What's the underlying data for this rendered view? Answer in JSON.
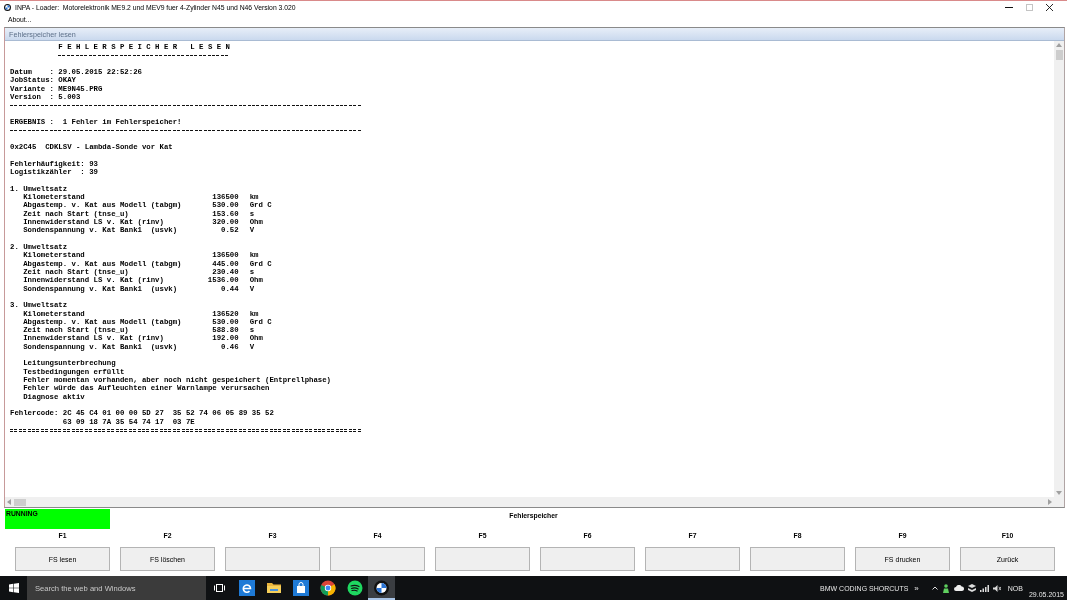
{
  "window": {
    "title": "INPA - Loader:  Motorelektronik ME9.2 und MEV9 fuer 4-Zylinder N45 und N46 Version 3.020",
    "controls": [
      {
        "kind": "minimize",
        "disabled": false
      },
      {
        "kind": "maximize",
        "disabled": true
      },
      {
        "kind": "close",
        "disabled": false
      }
    ]
  },
  "menu": [
    "About..."
  ],
  "panel": {
    "title": "Fehlerspeicher lesen"
  },
  "report": {
    "heading": "F E H L E R S P E I C H E R   L E S E N",
    "info": [
      "Datum    : 29.05.2015 22:52:26",
      "JobStatus: OKAY",
      "Variante : ME9N45.PRG",
      "Version  : 5.003"
    ],
    "result": "ERGEBNIS :  1 Fehler im Fehlerspeicher!",
    "fault": "0x2C45  CDKLSV - Lambda-Sonde vor Kat",
    "counters": [
      "Fehlerhäufigkeit: 93",
      "Logistikzähler  : 39"
    ],
    "environment_sets": [
      {
        "title": "1. Umweltsatz",
        "rows": [
          {
            "name": "Kilometerstand",
            "value": "136500",
            "unit": "km"
          },
          {
            "name": "Abgastemp. v. Kat aus Modell (tabgm)",
            "value": "530.00",
            "unit": "Grd C"
          },
          {
            "name": "Zeit nach Start (tnse_u)",
            "value": "153.60",
            "unit": "s"
          },
          {
            "name": "Innenwiderstand LS v. Kat (rinv)",
            "value": "320.00",
            "unit": "Ohm"
          },
          {
            "name": "Sondenspannung v. Kat Bank1  (usvk)",
            "value": "0.52",
            "unit": "V"
          }
        ]
      },
      {
        "title": "2. Umweltsatz",
        "rows": [
          {
            "name": "Kilometerstand",
            "value": "136500",
            "unit": "km"
          },
          {
            "name": "Abgastemp. v. Kat aus Modell (tabgm)",
            "value": "445.00",
            "unit": "Grd C"
          },
          {
            "name": "Zeit nach Start (tnse_u)",
            "value": "230.40",
            "unit": "s"
          },
          {
            "name": "Innenwiderstand LS v. Kat (rinv)",
            "value": "1536.00",
            "unit": "Ohm"
          },
          {
            "name": "Sondenspannung v. Kat Bank1  (usvk)",
            "value": "0.44",
            "unit": "V"
          }
        ]
      },
      {
        "title": "3. Umweltsatz",
        "rows": [
          {
            "name": "Kilometerstand",
            "value": "136520",
            "unit": "km"
          },
          {
            "name": "Abgastemp. v. Kat aus Modell (tabgm)",
            "value": "530.00",
            "unit": "Grd C"
          },
          {
            "name": "Zeit nach Start (tnse_u)",
            "value": "588.80",
            "unit": "s"
          },
          {
            "name": "Innenwiderstand LS v. Kat (rinv)",
            "value": "192.00",
            "unit": "Ohm"
          },
          {
            "name": "Sondenspannung v. Kat Bank1  (usvk)",
            "value": "0.46",
            "unit": "V"
          }
        ]
      }
    ],
    "conditions": [
      "Leitungsunterbrechung",
      "Testbedingungen erfüllt",
      "Fehler momentan vorhanden, aber noch nicht gespeichert (Entprellphase)",
      "Fehler würde das Aufleuchten einer Warnlampe verursachen",
      "Diagnose aktiv"
    ],
    "fault_code": {
      "label": "Fehlercode:",
      "lines": [
        "2C 45 C4 01 00 00 5D 27  35 52 74 06 05 89 35 52",
        "63 09 18 7A 35 54 74 17  03 7E"
      ]
    }
  },
  "status": {
    "label": "RUNNING",
    "running": true,
    "title": "Fehlerspeicher"
  },
  "function_keys": [
    {
      "key": "F1",
      "label": "FS lesen"
    },
    {
      "key": "F2",
      "label": "FS löschen"
    },
    {
      "key": "F3"
    },
    {
      "key": "F4"
    },
    {
      "key": "F5"
    },
    {
      "key": "F6"
    },
    {
      "key": "F7"
    },
    {
      "key": "F8"
    },
    {
      "key": "F9",
      "label": "FS drucken"
    },
    {
      "key": "F10",
      "label": "Zurück"
    }
  ],
  "taskbar": {
    "search": {
      "placeholder": "Search the web and Windows"
    },
    "apps": [
      {
        "kind": "edge",
        "active": false
      },
      {
        "kind": "explorer",
        "active": false
      },
      {
        "kind": "store",
        "active": false
      },
      {
        "kind": "chrome",
        "active": false
      },
      {
        "kind": "spotify",
        "active": false
      },
      {
        "kind": "inpa",
        "active": true
      }
    ],
    "toolbar_label": "BMW CODING SHORCUTS",
    "toolbar_more": "»",
    "language": "NOB",
    "date": "29.05.2015"
  }
}
